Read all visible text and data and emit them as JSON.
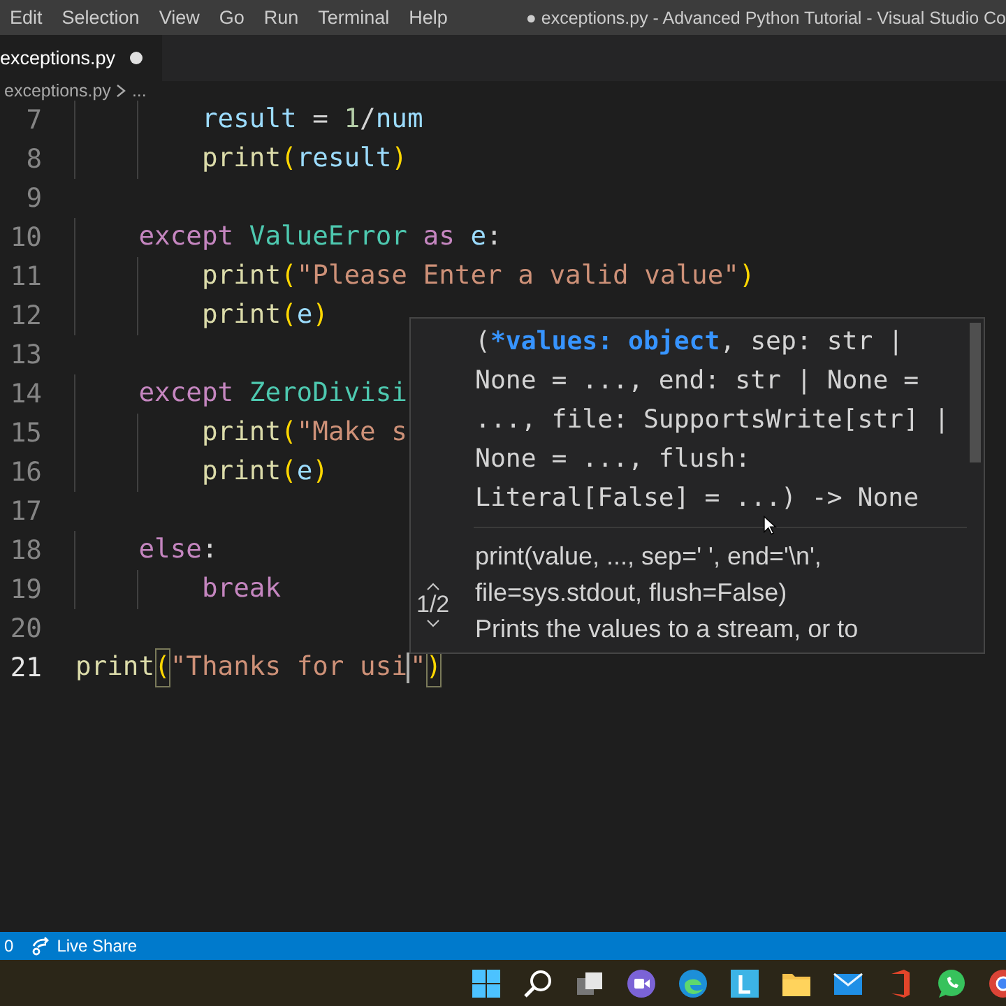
{
  "menu": [
    "Edit",
    "Selection",
    "View",
    "Go",
    "Run",
    "Terminal",
    "Help"
  ],
  "window": {
    "title": "● exceptions.py - Advanced Python Tutorial - Visual Studio Co"
  },
  "tabs": [
    {
      "label": "exceptions.py",
      "selected": true,
      "modified": true
    }
  ],
  "breadcrumb": [
    "exceptions.py",
    "..."
  ],
  "code_lines": [
    {
      "number": "7",
      "current": false,
      "tokens": [
        {
          "kind": "var",
          "text": "        result"
        },
        {
          "kind": "plain",
          "text": " = "
        },
        {
          "kind": "num",
          "text": "1"
        },
        {
          "kind": "plain",
          "text": "/"
        },
        {
          "kind": "var",
          "text": "num"
        }
      ]
    },
    {
      "number": "8",
      "current": false,
      "tokens": [
        {
          "kind": "func",
          "text": "        print"
        },
        {
          "kind": "paren",
          "text": "("
        },
        {
          "kind": "var",
          "text": "result"
        },
        {
          "kind": "paren",
          "text": ")"
        }
      ]
    },
    {
      "number": "9",
      "current": false
    },
    {
      "number": "10",
      "current": false,
      "tokens": [
        {
          "kind": "keyword",
          "text": "    except "
        },
        {
          "kind": "class",
          "text": "ValueError "
        },
        {
          "kind": "keyword",
          "text": "as "
        },
        {
          "kind": "var",
          "text": "e"
        },
        {
          "kind": "plain",
          "text": ":"
        }
      ]
    },
    {
      "number": "11",
      "current": false,
      "tokens": [
        {
          "kind": "func",
          "text": "        print"
        },
        {
          "kind": "paren",
          "text": "("
        },
        {
          "kind": "string",
          "text": "\"Please Enter a valid value\""
        },
        {
          "kind": "paren",
          "text": ")"
        }
      ]
    },
    {
      "number": "12",
      "current": false,
      "tokens": [
        {
          "kind": "func",
          "text": "        print"
        },
        {
          "kind": "paren",
          "text": "("
        },
        {
          "kind": "var",
          "text": "e"
        },
        {
          "kind": "paren",
          "text": ")"
        }
      ]
    },
    {
      "number": "13",
      "current": false
    },
    {
      "number": "14",
      "current": false,
      "tokens": [
        {
          "kind": "keyword",
          "text": "    except "
        },
        {
          "kind": "class",
          "text": "ZeroDivisi"
        }
      ]
    },
    {
      "number": "15",
      "current": false,
      "tokens": [
        {
          "kind": "func",
          "text": "        print"
        },
        {
          "kind": "paren",
          "text": "("
        },
        {
          "kind": "string",
          "text": "\"Make s"
        }
      ]
    },
    {
      "number": "16",
      "current": false,
      "tokens": [
        {
          "kind": "func",
          "text": "        print"
        },
        {
          "kind": "paren",
          "text": "("
        },
        {
          "kind": "var",
          "text": "e"
        },
        {
          "kind": "paren",
          "text": ")"
        }
      ]
    },
    {
      "number": "17",
      "current": false
    },
    {
      "number": "18",
      "current": false,
      "tokens": [
        {
          "kind": "keyword",
          "text": "    else"
        },
        {
          "kind": "plain",
          "text": ":"
        }
      ]
    },
    {
      "number": "19",
      "current": false,
      "tokens": [
        {
          "kind": "keyword",
          "text": "        break"
        }
      ]
    },
    {
      "number": "20",
      "current": false
    },
    {
      "number": "21",
      "current": true,
      "tokens": [
        {
          "kind": "func",
          "text": "print"
        },
        {
          "kind": "paren-match",
          "text": "("
        },
        {
          "kind": "string",
          "text": "\"Thanks for usi"
        },
        {
          "kind": "cursor"
        },
        {
          "kind": "string",
          "text": "\""
        },
        {
          "kind": "paren-match",
          "text": ")"
        }
      ]
    }
  ],
  "signature_help": {
    "counter": "1/2",
    "signature_lines": [
      [
        {
          "kind": "plain",
          "text": "("
        },
        {
          "kind": "param",
          "text": "*values: object"
        },
        {
          "kind": "plain",
          "text": ", sep: str |"
        }
      ],
      [
        {
          "kind": "plain",
          "text": "None = ..., end: str | None ="
        }
      ],
      [
        {
          "kind": "plain",
          "text": "..., file: SupportsWrite[str] |"
        }
      ],
      [
        {
          "kind": "plain",
          "text": "None = ..., flush:"
        }
      ],
      [
        {
          "kind": "plain",
          "text": "Literal[False] = ...) -> None"
        }
      ]
    ],
    "doc_lines": [
      "print(value, ..., sep=' ', end='\\n',",
      "file=sys.stdout, flush=False)",
      "Prints the values to a stream, or to"
    ]
  },
  "status_bar": {
    "items": [
      {
        "kind": "text",
        "label": "0"
      },
      {
        "kind": "live-share",
        "label": "Live Share"
      }
    ]
  }
}
